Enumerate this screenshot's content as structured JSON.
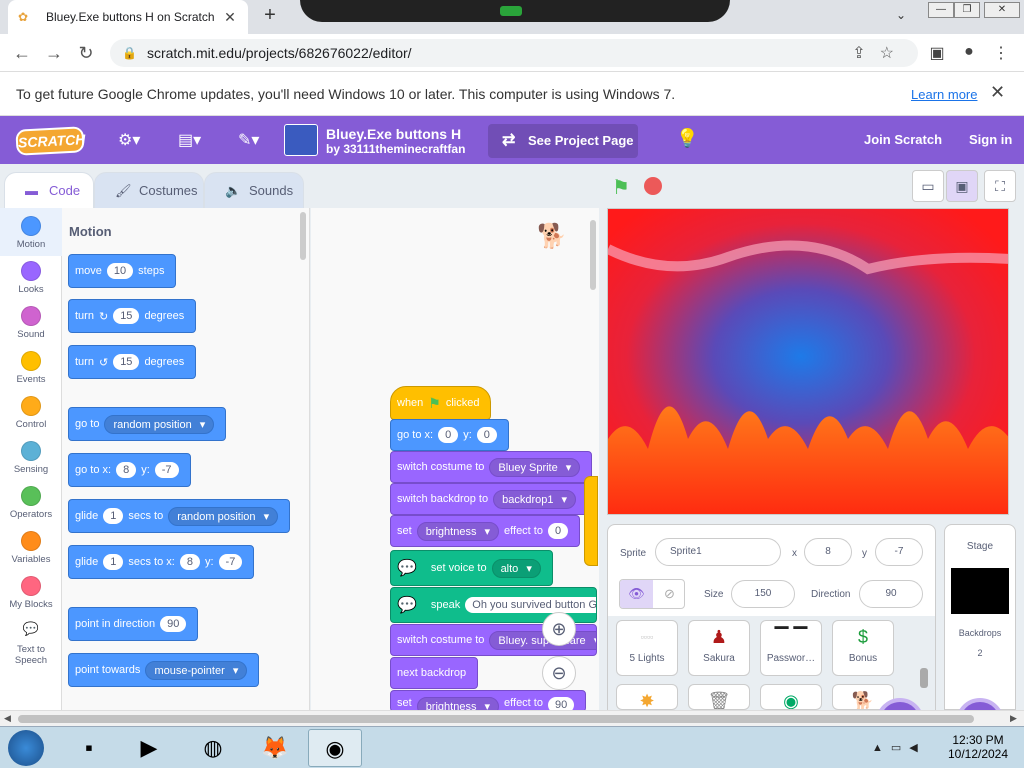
{
  "browser": {
    "tab_title": "Bluey.Exe buttons H on Scratch",
    "url": "scratch.mit.edu/projects/682676022/editor/",
    "infobar_message": "To get future Google Chrome updates, you'll need Windows 10 or later. This computer is using Windows 7.",
    "infobar_link": "Learn more"
  },
  "menubar": {
    "logo": "SCRATCH",
    "project_title": "Bluey.Exe buttons H",
    "project_author": "by 33111theminecraftfan",
    "see_project_page": "See Project Page",
    "join": "Join Scratch",
    "sign_in": "Sign in"
  },
  "editor_tabs": [
    "Code",
    "Costumes",
    "Sounds"
  ],
  "categories": [
    {
      "label": "Motion",
      "color": "#4c97ff"
    },
    {
      "label": "Looks",
      "color": "#9966ff"
    },
    {
      "label": "Sound",
      "color": "#cf63cf"
    },
    {
      "label": "Events",
      "color": "#ffbf00"
    },
    {
      "label": "Control",
      "color": "#ffab19"
    },
    {
      "label": "Sensing",
      "color": "#5cb1d6"
    },
    {
      "label": "Operators",
      "color": "#59c059"
    },
    {
      "label": "Variables",
      "color": "#ff8c1a"
    },
    {
      "label": "My Blocks",
      "color": "#ff6680"
    },
    {
      "label": "Text to Speech",
      "color": "#0fbd8c"
    }
  ],
  "palette": {
    "heading": "Motion",
    "blocks": {
      "move": {
        "a": "move",
        "v": "10",
        "b": "steps"
      },
      "turn_right": {
        "a": "turn",
        "icon": "↻",
        "v": "15",
        "b": "degrees"
      },
      "turn_left": {
        "a": "turn",
        "icon": "↺",
        "v": "15",
        "b": "degrees"
      },
      "goto": {
        "a": "go to",
        "d": "random position"
      },
      "gotoxy": {
        "a": "go to x:",
        "x": "8",
        "ylbl": "y:",
        "y": "-7"
      },
      "glide": {
        "a": "glide",
        "v": "1",
        "b": "secs to",
        "d": "random position"
      },
      "glidexy": {
        "a": "glide",
        "v": "1",
        "b": "secs to x:",
        "x": "8",
        "ylbl": "y:",
        "y": "-7"
      },
      "point_dir": {
        "a": "point in direction",
        "v": "90"
      },
      "point_towards": {
        "a": "point towards",
        "d": "mouse-pointer"
      }
    }
  },
  "script": {
    "when": "when",
    "clicked": "clicked",
    "goto_a": "go to x:",
    "goto_x": "0",
    "goto_ylbl": "y:",
    "goto_y": "0",
    "costume_a": "switch costume to",
    "costume_d": "Bluey Sprite",
    "backdrop_a": "switch backdrop to",
    "backdrop_d": "backdrop1",
    "set_a": "set",
    "set_d": "brightness",
    "set_b": "effect to",
    "set_v": "0",
    "voice_a": "set voice to",
    "voice_d": "alto",
    "speak_a": "speak",
    "speak_v": "Oh you survived button G",
    "costume2_a": "switch costume to",
    "costume2_d": "Bluey. superscare",
    "next_backdrop": "next backdrop",
    "set2_a": "set",
    "set2_d": "brightness",
    "set2_b": "effect to",
    "set2_v": "90"
  },
  "sprite_info": {
    "sprite_label": "Sprite",
    "sprite_name": "Sprite1",
    "x_label": "x",
    "x": "8",
    "y_label": "y",
    "y": "-7",
    "size_label": "Size",
    "size": "150",
    "direction_label": "Direction",
    "direction": "90"
  },
  "sprites": [
    "5 Lights",
    "Sakura",
    "Passwor…",
    "Bonus"
  ],
  "stage_pane": {
    "title": "Stage",
    "backdrops_label": "Backdrops",
    "backdrops_count": "2"
  },
  "taskbar": {
    "time": "12:30 PM",
    "date": "10/12/2024"
  }
}
